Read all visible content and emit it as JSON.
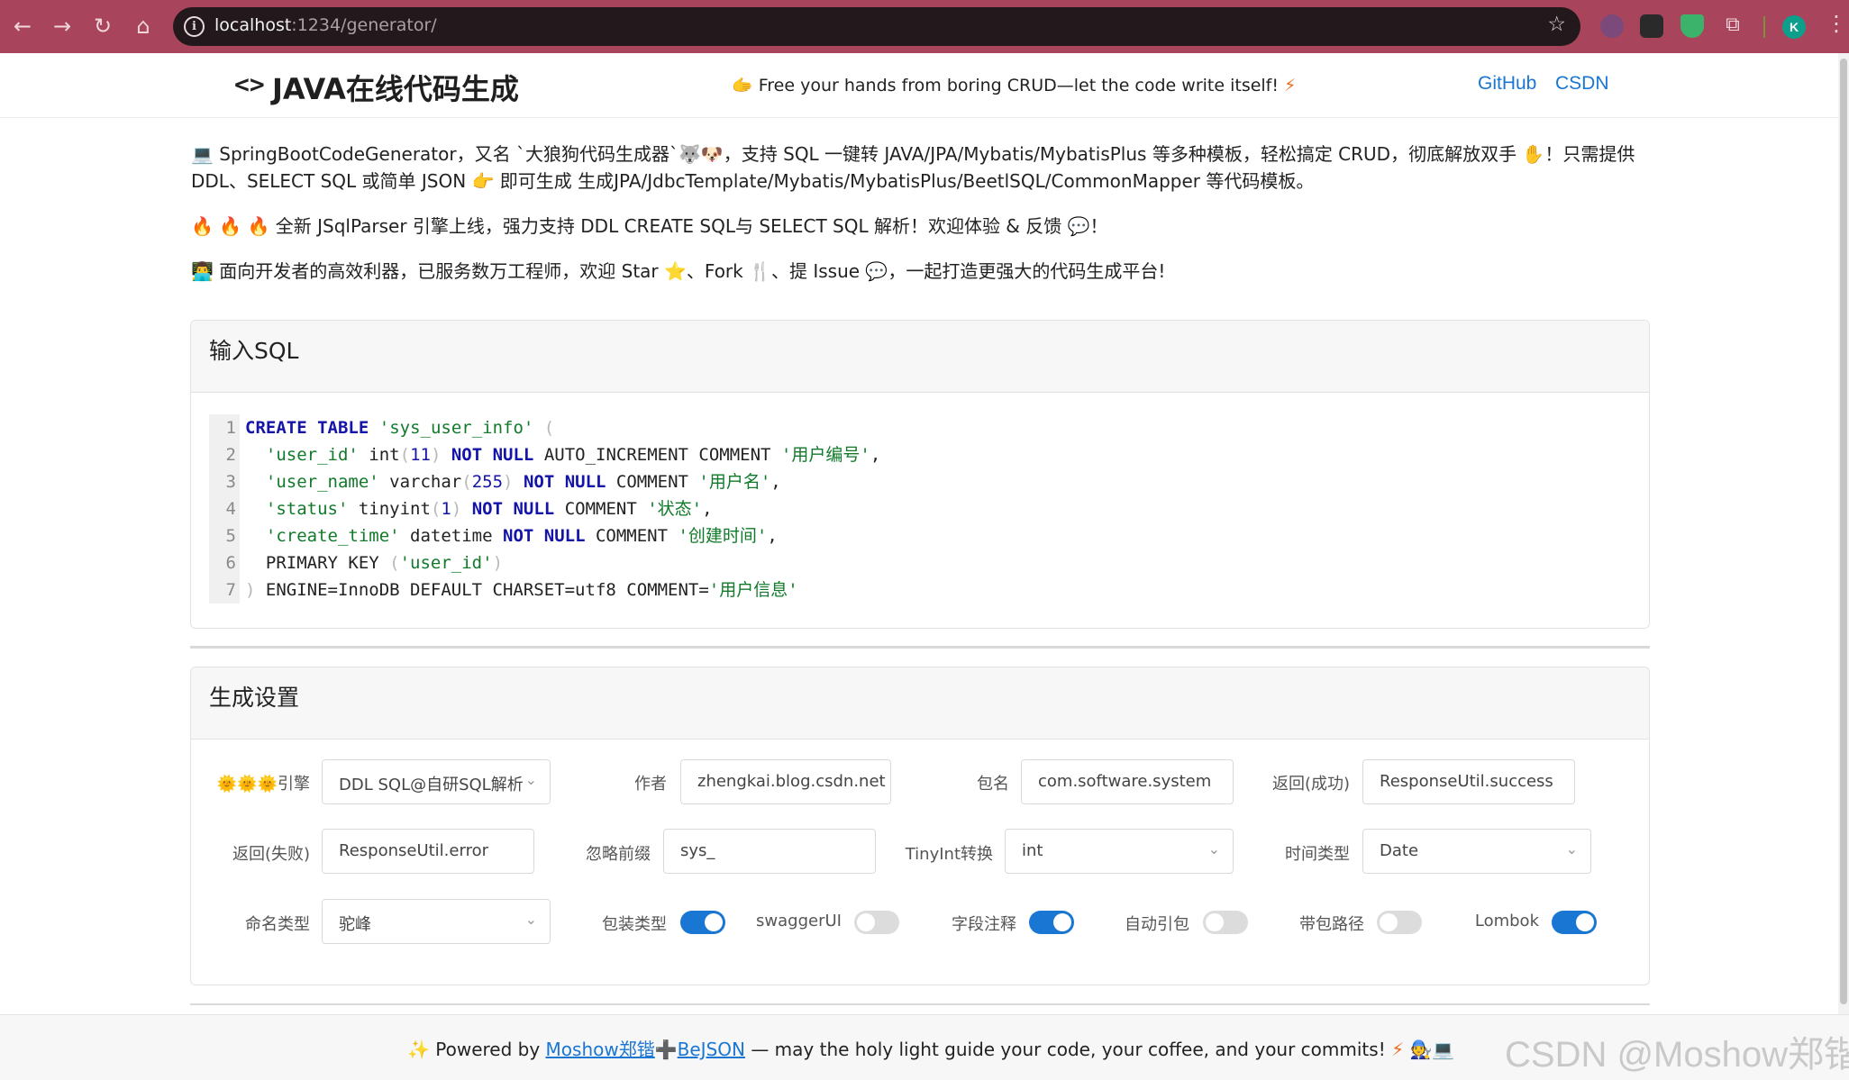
{
  "browser": {
    "url_host": "localhost",
    "url_path": ":1234/generator/",
    "profile_initial": "K"
  },
  "header": {
    "brand_icon": "code-brackets-icon",
    "title": "JAVA在线代码生成",
    "tagline_emoji": "🫱",
    "tagline": "Free your hands from boring CRUD—let the code write itself!",
    "tagline_bolt": "⚡",
    "links": [
      "GitHub",
      "CSDN"
    ]
  },
  "intro": {
    "p1_emoji": "💻",
    "p1": "SpringBootCodeGenerator，又名 `大狼狗代码生成器`🐺🐶，支持 SQL 一键转 JAVA/JPA/Mybatis/MybatisPlus 等多种模板，轻松搞定 CRUD，彻底解放双手 ✋！只需提供 DDL、SELECT SQL 或简单 JSON 👉 即可生成 生成JPA/JdbcTemplate/Mybatis/MybatisPlus/BeetlSQL/CommonMapper 等代码模板。",
    "p2_emoji": "🔥 🔥 🔥",
    "p2": "全新 JSqlParser 引擎上线，强力支持 DDL CREATE SQL与 SELECT SQL 解析！欢迎体验 & 反馈 💬！",
    "p3_emoji": "👨‍💻",
    "p3": "面向开发者的高效利器，已服务数万工程师，欢迎 Star ⭐、Fork 🍴、提 Issue 💬，一起打造更强大的代码生成平台!"
  },
  "sql_card": {
    "title": "输入SQL",
    "lines": [
      {
        "n": "1"
      },
      {
        "n": "2"
      },
      {
        "n": "3"
      },
      {
        "n": "4"
      },
      {
        "n": "5"
      },
      {
        "n": "6"
      },
      {
        "n": "7"
      }
    ],
    "tokens": {
      "create": "CREATE",
      "table": "TABLE",
      "tname": "'sys_user_info'",
      "lp": "(",
      "c1": "'user_id'",
      "c1t": " int",
      "c1p": "(",
      "c1n": "11",
      "c1q": ")",
      "c1a": "NOT NULL",
      "c1b": " AUTO_INCREMENT COMMENT ",
      "c1c": "'用户编号'",
      "c1d": ",",
      "c2": "'user_name'",
      "c2t": " varchar",
      "c2p": "(",
      "c2n": "255",
      "c2q": ")",
      "c2a": "NOT NULL",
      "c2b": " COMMENT ",
      "c2c": "'用户名'",
      "c2d": ",",
      "c3": "'status'",
      "c3t": " tinyint",
      "c3p": "(",
      "c3n": "1",
      "c3q": ")",
      "c3a": "NOT NULL",
      "c3b": " COMMENT ",
      "c3c": "'状态'",
      "c3d": ",",
      "c4": "'create_time'",
      "c4t": " datetime ",
      "c4a": "NOT NULL",
      "c4b": " COMMENT ",
      "c4c": "'创建时间'",
      "c4d": ",",
      "pk": "  PRIMARY KEY ",
      "pkp": "(",
      "pkc": "'user_id'",
      "pkq": ")",
      "rp": ")",
      "eng": " ENGINE=InnoDB DEFAULT CHARSET=utf8 COMMENT=",
      "engc": "'用户信息'"
    }
  },
  "settings_card": {
    "title": "生成设置",
    "engine_label_suns": "🌞🌞🌞",
    "engine_label": "引擎",
    "engine_value": "DDL SQL@自研SQL解析",
    "author_label": "作者",
    "author_value": "zhengkai.blog.csdn.net",
    "package_label": "包名",
    "package_value": "com.software.system",
    "return_success_label": "返回(成功)",
    "return_success_value": "ResponseUtil.success",
    "return_fail_label": "返回(失败)",
    "return_fail_value": "ResponseUtil.error",
    "ignore_prefix_label": "忽略前缀",
    "ignore_prefix_value": "sys_",
    "tinyint_label": "TinyInt转换",
    "tinyint_value": "int",
    "time_type_label": "时间类型",
    "time_type_value": "Date",
    "naming_label": "命名类型",
    "naming_value": "驼峰",
    "toggles": [
      {
        "label": "包装类型",
        "on": true
      },
      {
        "label": "swaggerUI",
        "on": false
      },
      {
        "label": "字段注释",
        "on": true
      },
      {
        "label": "自动引包",
        "on": false
      },
      {
        "label": "带包路径",
        "on": false
      },
      {
        "label": "Lombok",
        "on": true
      }
    ]
  },
  "footer": {
    "sparkle": "✨",
    "powered_by": "Powered by",
    "link1": "Moshow郑锴",
    "plus": "➕",
    "link2": "BeJSON",
    "message": "— may the holy light guide your code, your coffee, and your commits!",
    "bolt": "⚡",
    "emojis": "🧑‍🔧💻"
  },
  "watermark": "CSDN @Moshow郑锴",
  "colors": {
    "accent": "#1976d2",
    "chrome": "#a8455c"
  }
}
